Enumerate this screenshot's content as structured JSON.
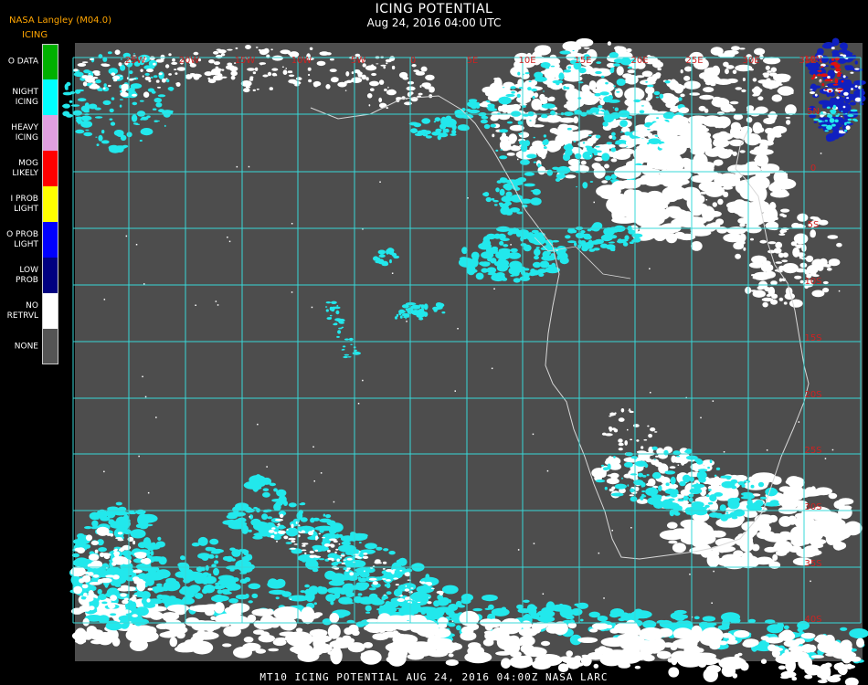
{
  "header": {
    "source": "NASA Langley (M04.0)",
    "product": "ICING",
    "title": "ICING POTENTIAL",
    "datetime": "Aug 24, 2016 04:00 UTC"
  },
  "legend": [
    {
      "label": "O DATA",
      "color": "#00b000"
    },
    {
      "label": "NIGHT\nICING",
      "color": "#00ffff"
    },
    {
      "label": "HEAVY\nICING",
      "color": "#e0a0e0"
    },
    {
      "label": "MOG\nLIKELY",
      "color": "#ff0000"
    },
    {
      "label": "I PROB\nLIGHT",
      "color": "#ffff00"
    },
    {
      "label": "O PROB\nLIGHT",
      "color": "#0000ff"
    },
    {
      "label": "LOW\nPROB",
      "color": "#000080"
    },
    {
      "label": "NO\nRETRVL",
      "color": "#ffffff"
    },
    {
      "label": "NONE",
      "color": "#555555"
    }
  ],
  "map": {
    "colors": {
      "ocean": "#4d4d4d",
      "grid": "#38d8d8",
      "label": "#cc2222",
      "coast": "#d8d8d8",
      "cyan": "#22e8ec",
      "white": "#ffffff"
    },
    "lon_labels": [
      "25W",
      "20W",
      "15W",
      "10W",
      "5W",
      "0",
      "5E",
      "10E",
      "15E",
      "20E",
      "25E",
      "30E",
      "35E"
    ],
    "lat_labels": [
      "10N",
      "5N",
      "0",
      "5S",
      "10S",
      "15S",
      "20S",
      "25S",
      "30S",
      "35S",
      "40S"
    ]
  },
  "footer": "MT10  ICING POTENTIAL    AUG 24, 2016 04:00Z    NASA LARC"
}
